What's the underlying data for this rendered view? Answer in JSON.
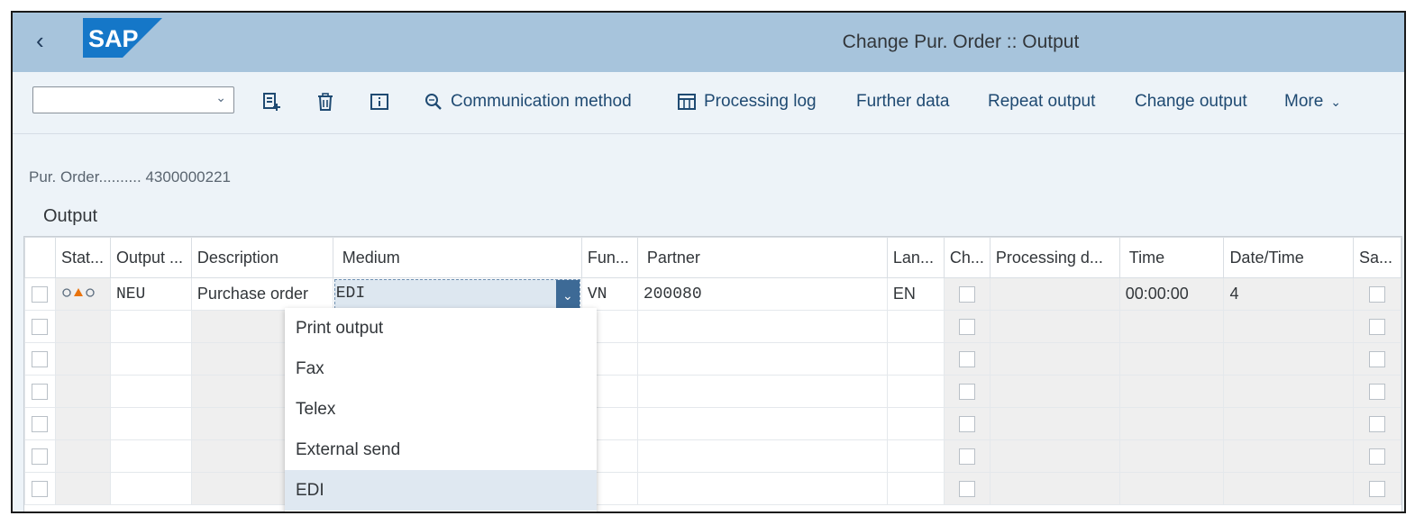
{
  "shell": {
    "logo_text": "SAP",
    "title": "Change Pur. Order :: Output"
  },
  "toolbar": {
    "combo_value": "",
    "communication_method": "Communication method",
    "processing_log": "Processing log",
    "further_data": "Further data",
    "repeat_output": "Repeat output",
    "change_output": "Change output",
    "more": "More"
  },
  "header": {
    "purchase_order_label": "Pur. Order..........",
    "purchase_order_number": "4300000221",
    "section_title": "Output"
  },
  "table": {
    "columns": [
      "Stat...",
      "Output ...",
      "Description",
      "Medium",
      "Fun...",
      "Partner",
      "Lan...",
      "Ch...",
      "Processing d...",
      "Time",
      "Date/Time",
      "Sa..."
    ],
    "row1": {
      "output_type": "NEU",
      "description": "Purchase order",
      "medium": "EDI",
      "function": "VN",
      "partner": "200080",
      "language": "EN",
      "time": "00:00:00",
      "date_time": "4"
    }
  },
  "dropdown": {
    "options": [
      "Print output",
      "Fax",
      "Telex",
      "External send",
      "EDI"
    ],
    "selected": "EDI"
  },
  "colors": {
    "shell": "#a7c4dc",
    "accent": "#3d6a96",
    "status_warning": "#e9730c"
  }
}
